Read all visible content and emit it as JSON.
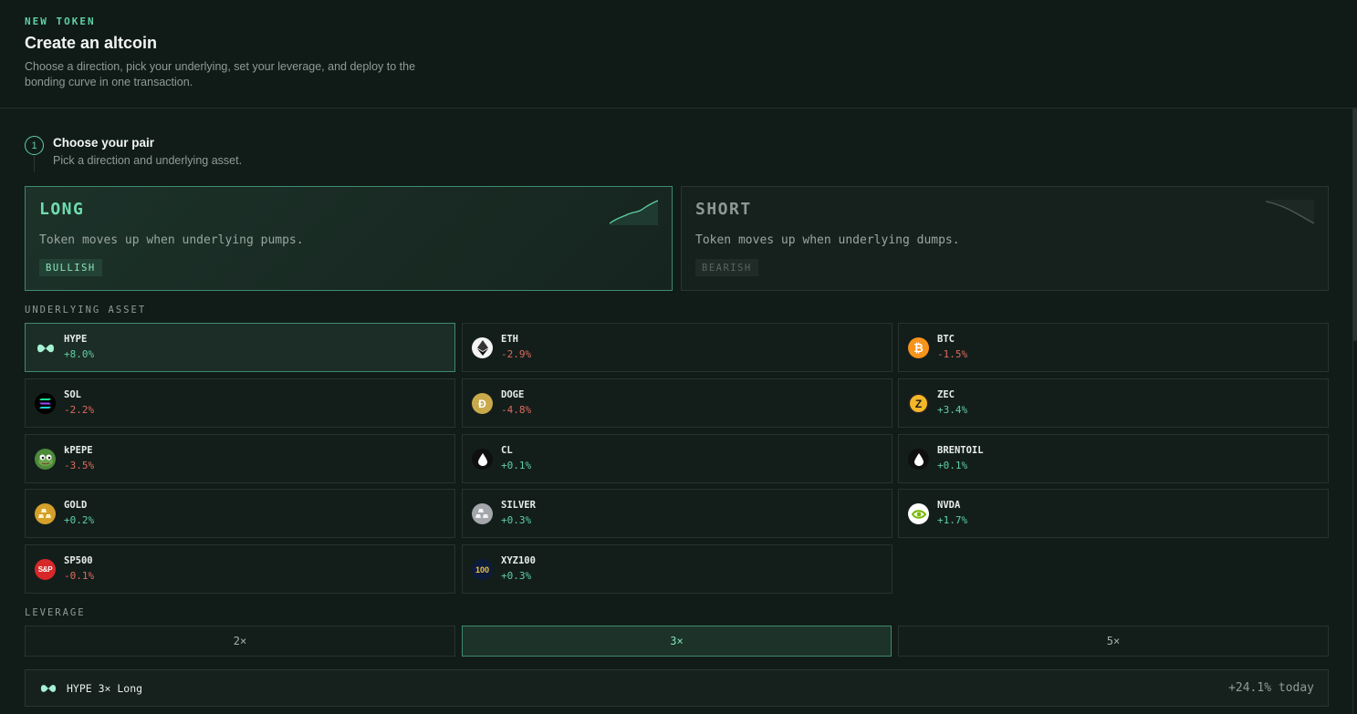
{
  "header": {
    "eyebrow": "NEW TOKEN",
    "title": "Create an altcoin",
    "subtitle": "Choose a direction, pick your underlying, set your leverage, and deploy to the bonding curve in one transaction."
  },
  "step": {
    "number": "1",
    "title": "Choose your pair",
    "subtitle": "Pick a direction and underlying asset."
  },
  "directions": [
    {
      "label": "LONG",
      "description": "Token moves up when underlying pumps.",
      "badge": "BULLISH",
      "selected": true
    },
    {
      "label": "SHORT",
      "description": "Token moves up when underlying dumps.",
      "badge": "BEARISH",
      "selected": false
    }
  ],
  "underlying_label": "UNDERLYING ASSET",
  "assets": [
    {
      "symbol": "HYPE",
      "change": "+8.0%",
      "icon": "hype-icon",
      "selected": true
    },
    {
      "symbol": "ETH",
      "change": "-2.9%",
      "icon": "eth-icon"
    },
    {
      "symbol": "BTC",
      "change": "-1.5%",
      "icon": "btc-icon"
    },
    {
      "symbol": "SOL",
      "change": "-2.2%",
      "icon": "sol-icon"
    },
    {
      "symbol": "DOGE",
      "change": "-4.8%",
      "icon": "doge-icon"
    },
    {
      "symbol": "ZEC",
      "change": "+3.4%",
      "icon": "zec-icon"
    },
    {
      "symbol": "kPEPE",
      "change": "-3.5%",
      "icon": "pepe-icon"
    },
    {
      "symbol": "CL",
      "change": "+0.1%",
      "icon": "oil-drop-icon"
    },
    {
      "symbol": "BRENTOIL",
      "change": "+0.1%",
      "icon": "oil-drop-icon"
    },
    {
      "symbol": "GOLD",
      "change": "+0.2%",
      "icon": "gold-bars-icon"
    },
    {
      "symbol": "SILVER",
      "change": "+0.3%",
      "icon": "silver-bars-icon"
    },
    {
      "symbol": "NVDA",
      "change": "+1.7%",
      "icon": "nvda-icon"
    },
    {
      "symbol": "SP500",
      "change": "-0.1%",
      "icon": "sp500-icon",
      "icon_text": "S&P"
    },
    {
      "symbol": "XYZ100",
      "change": "+0.3%",
      "icon": "xyz100-icon",
      "icon_text": "100"
    }
  ],
  "leverage_label": "LEVERAGE",
  "leverage": [
    {
      "label": "2×",
      "selected": false
    },
    {
      "label": "3×",
      "selected": true
    },
    {
      "label": "5×",
      "selected": false
    }
  ],
  "summary": {
    "text": "HYPE 3× Long",
    "today": "+24.1% today"
  },
  "colors": {
    "accent": "#5fd0a4",
    "negative": "#e06a5c",
    "background": "#101a17"
  }
}
